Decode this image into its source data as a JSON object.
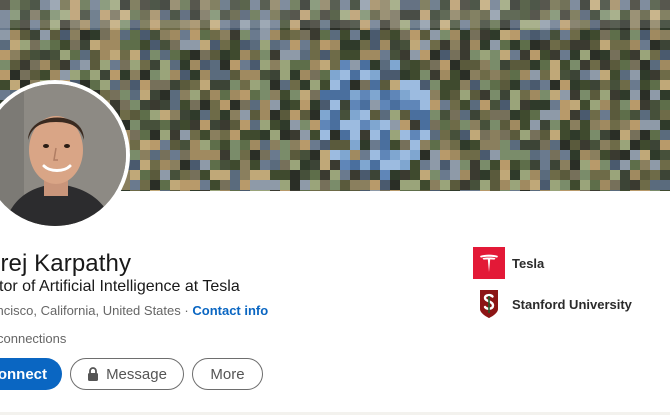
{
  "profile": {
    "name": "drej Karpathy",
    "headline": "ctor of Artificial Intelligence at Tesla",
    "location": "Francisco, California, United States",
    "separator": "·",
    "contact_label": "Contact info",
    "connections": "connections"
  },
  "actions": {
    "connect_label": "onnect",
    "message_label": "Message",
    "more_label": "More"
  },
  "experience": [
    {
      "label": "Tesla",
      "logo": "tesla-logo"
    },
    {
      "label": "Stanford University",
      "logo": "stanford-logo"
    }
  ],
  "colors": {
    "primary": "#0a66c2",
    "tesla_red": "#e31937",
    "stanford_red": "#8c1515",
    "text": "#191919",
    "muted": "#666666"
  }
}
